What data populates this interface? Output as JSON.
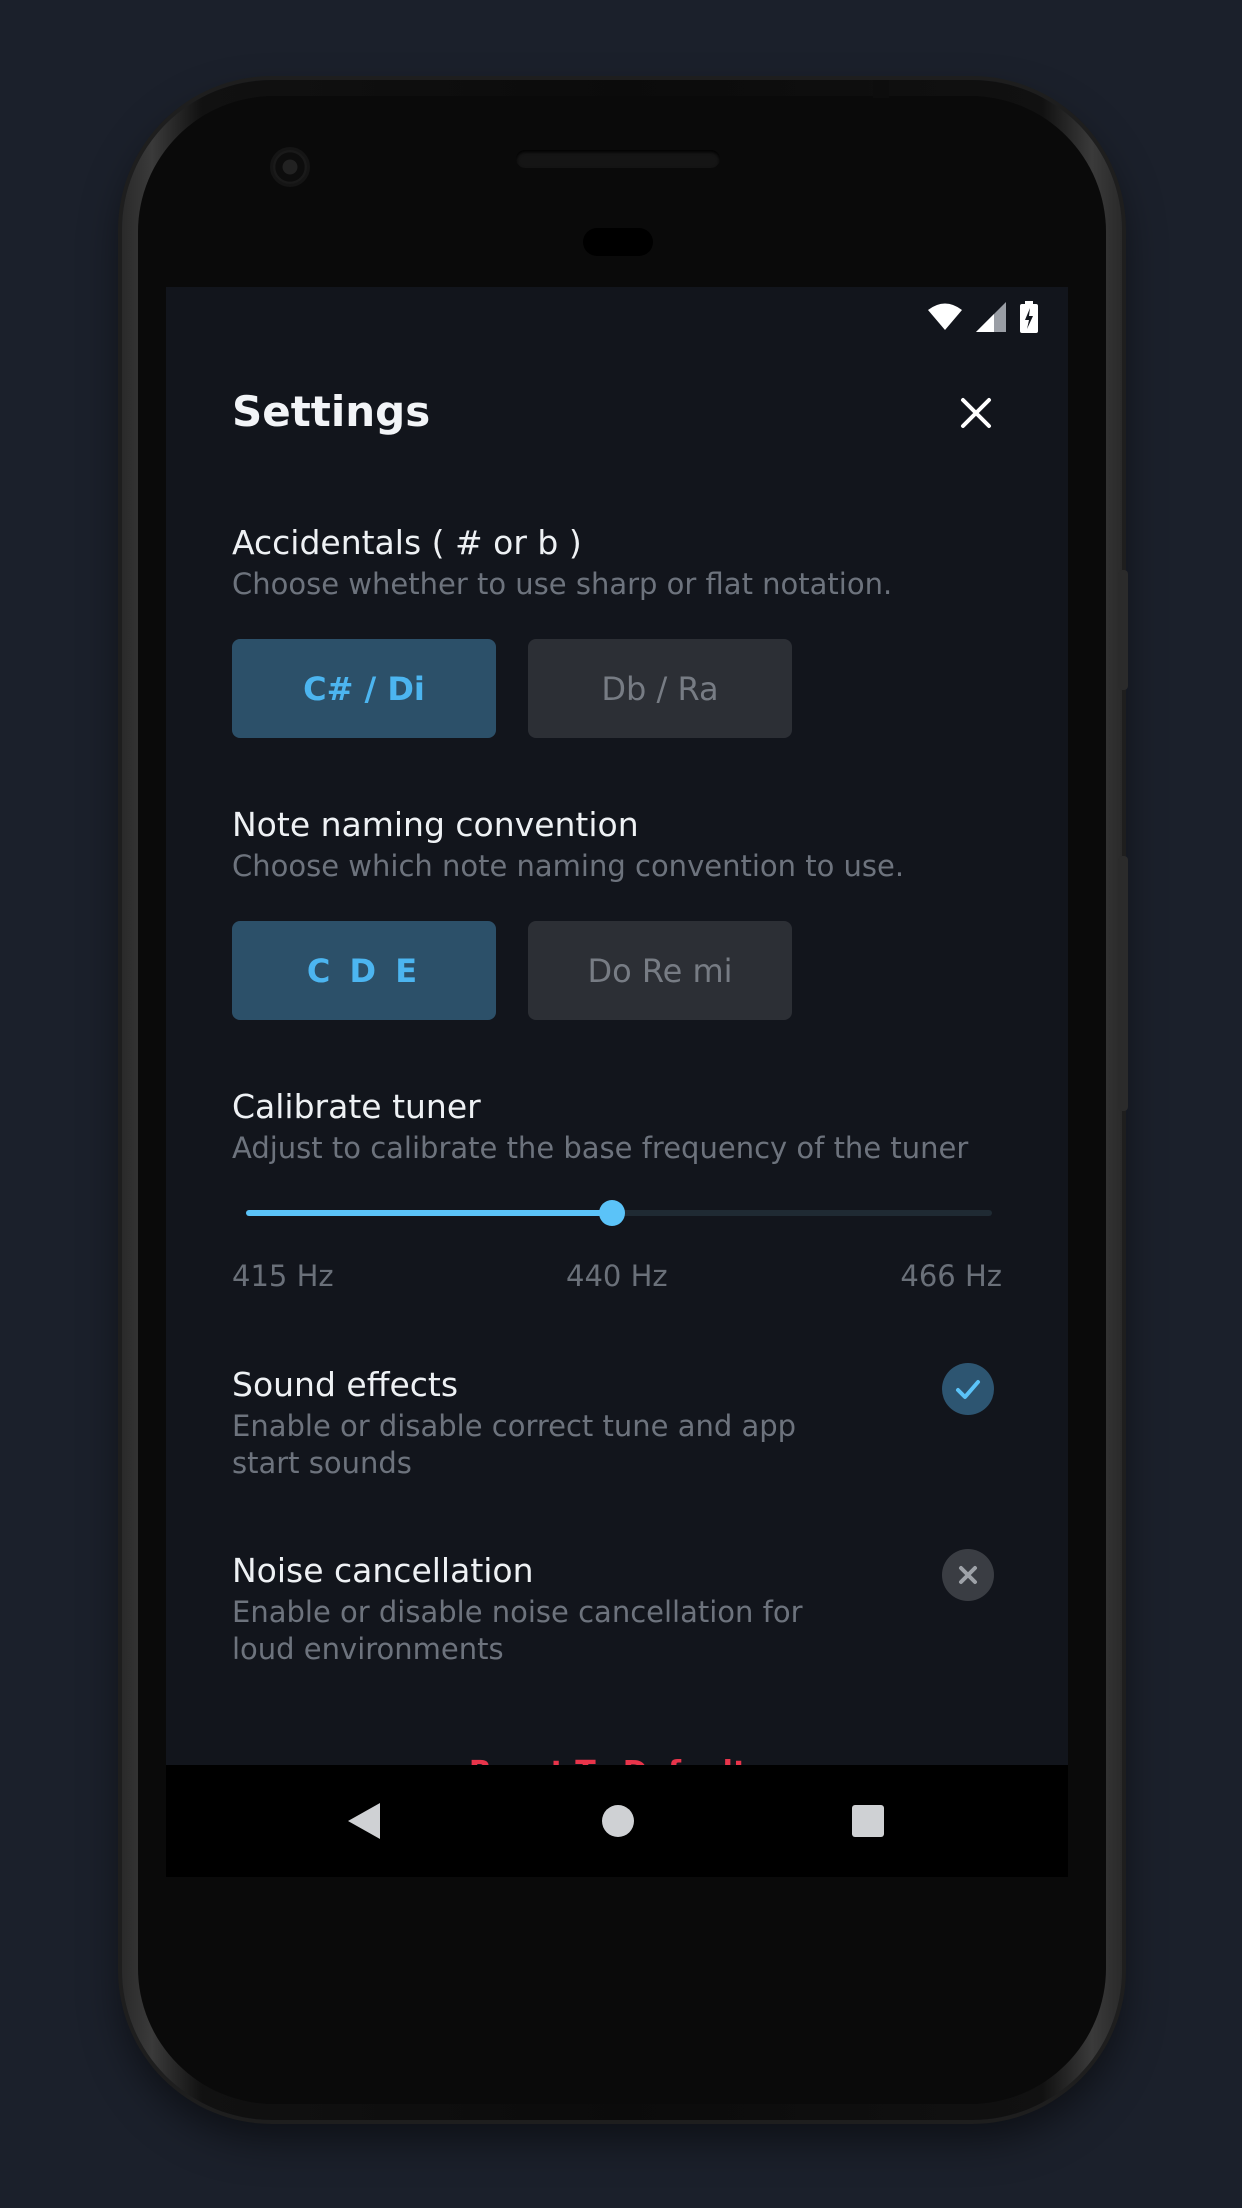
{
  "header": {
    "title": "Settings"
  },
  "accidentals": {
    "title": "Accidentals ( # or b )",
    "subtitle": "Choose whether to use sharp or flat notation.",
    "options": [
      {
        "label": "C# / Di",
        "selected": true
      },
      {
        "label": "Db / Ra",
        "selected": false
      }
    ]
  },
  "naming": {
    "title": "Note naming convention",
    "subtitle": "Choose which note naming convention to use.",
    "options": [
      {
        "label": "C D E",
        "selected": true
      },
      {
        "label": "Do Re mi",
        "selected": false
      }
    ]
  },
  "calibrate": {
    "title": "Calibrate tuner",
    "subtitle": "Adjust to calibrate the base frequency of the tuner",
    "min_label": "415 Hz",
    "mid_label": "440 Hz",
    "max_label": "466 Hz",
    "min": 415,
    "max": 466,
    "value": 440
  },
  "sound_effects": {
    "title": "Sound effects",
    "subtitle_line1": "Enable or disable correct tune and app",
    "subtitle_line2": "start sounds",
    "enabled": true
  },
  "noise_cancellation": {
    "title": "Noise cancellation",
    "subtitle_line1": "Enable or disable noise cancellation for",
    "subtitle_line2": "loud environments",
    "enabled": false
  },
  "footer": {
    "reset_label": "Reset To Defaults"
  },
  "colors": {
    "accent": "#5bc3f8",
    "active_bg": "#2c5069",
    "inactive_bg": "#2c2f35",
    "screen_bg": "#12151c",
    "danger": "#e8344a"
  },
  "icons": {
    "status": [
      "wifi-icon",
      "signal-icon",
      "battery-icon"
    ],
    "close": "close-icon",
    "check": "check-icon",
    "x": "x-icon",
    "nav": [
      "back-icon",
      "home-icon",
      "recents-icon"
    ]
  }
}
